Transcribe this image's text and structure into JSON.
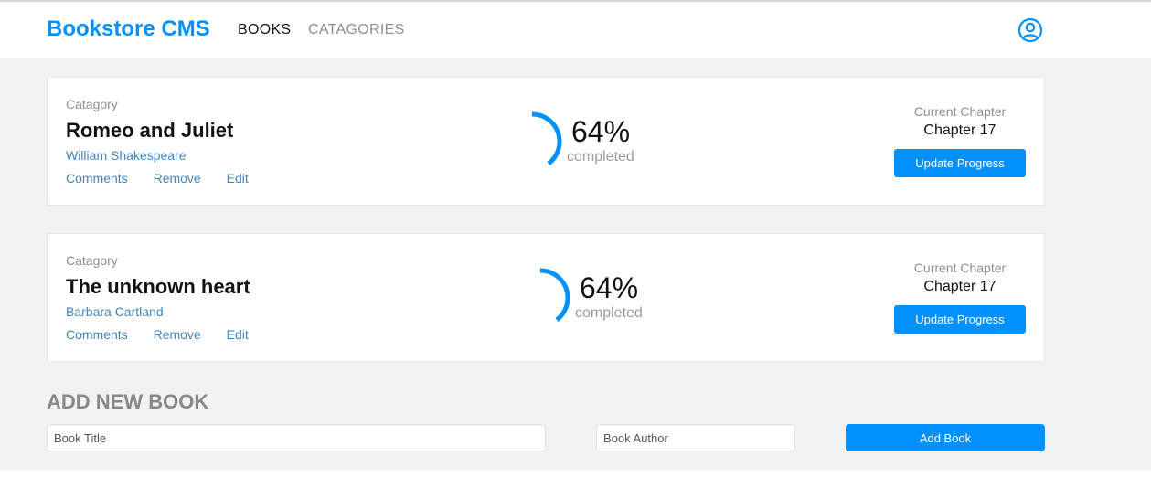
{
  "header": {
    "brand": "Bookstore CMS",
    "nav": {
      "books": "BOOKS",
      "categories": "CATAGORIES"
    },
    "user_icon": "user-circle-icon"
  },
  "books": [
    {
      "category": "Catagory",
      "title": "Romeo and Juliet",
      "author": "William Shakespeare",
      "actions": {
        "comments": "Comments",
        "remove": "Remove",
        "edit": "Edit"
      },
      "progress": {
        "percent": 64,
        "percent_label": "64%",
        "completed_label": "completed"
      },
      "chapter": {
        "label": "Current Chapter",
        "value": "Chapter 17"
      },
      "update_label": "Update Progress"
    },
    {
      "category": "Catagory",
      "title": "The unknown heart",
      "author": "Barbara Cartland",
      "actions": {
        "comments": "Comments",
        "remove": "Remove",
        "edit": "Edit"
      },
      "progress": {
        "percent": 64,
        "percent_label": "64%",
        "completed_label": "completed"
      },
      "chapter": {
        "label": "Current Chapter",
        "value": "Chapter 17"
      },
      "update_label": "Update Progress"
    }
  ],
  "add_form": {
    "heading": "ADD NEW BOOK",
    "title_placeholder": "Book Title",
    "author_placeholder": "Book Author",
    "submit_label": "Add Book"
  },
  "colors": {
    "accent": "#0290ff",
    "link": "#4386bf",
    "background": "#f2f2f2"
  }
}
